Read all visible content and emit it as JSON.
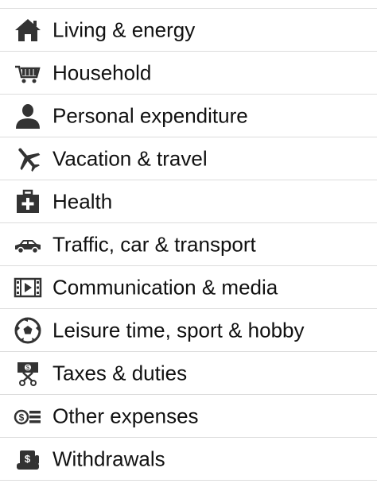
{
  "colors": {
    "icon": "#333333",
    "text": "#111111",
    "divider": "#dcdcdc"
  },
  "categories": [
    {
      "label": "Living & energy",
      "icon": "house-icon"
    },
    {
      "label": "Household",
      "icon": "shopping-cart-icon"
    },
    {
      "label": "Personal expenditure",
      "icon": "person-icon"
    },
    {
      "label": "Vacation & travel",
      "icon": "airplane-icon"
    },
    {
      "label": "Health",
      "icon": "first-aid-kit-icon"
    },
    {
      "label": "Traffic, car & transport",
      "icon": "car-icon"
    },
    {
      "label": "Communication & media",
      "icon": "film-strip-icon"
    },
    {
      "label": "Leisure time, sport & hobby",
      "icon": "soccer-ball-icon"
    },
    {
      "label": "Taxes & duties",
      "icon": "money-scissors-icon"
    },
    {
      "label": "Other expenses",
      "icon": "coins-icon"
    },
    {
      "label": "Withdrawals",
      "icon": "money-hand-icon"
    }
  ]
}
